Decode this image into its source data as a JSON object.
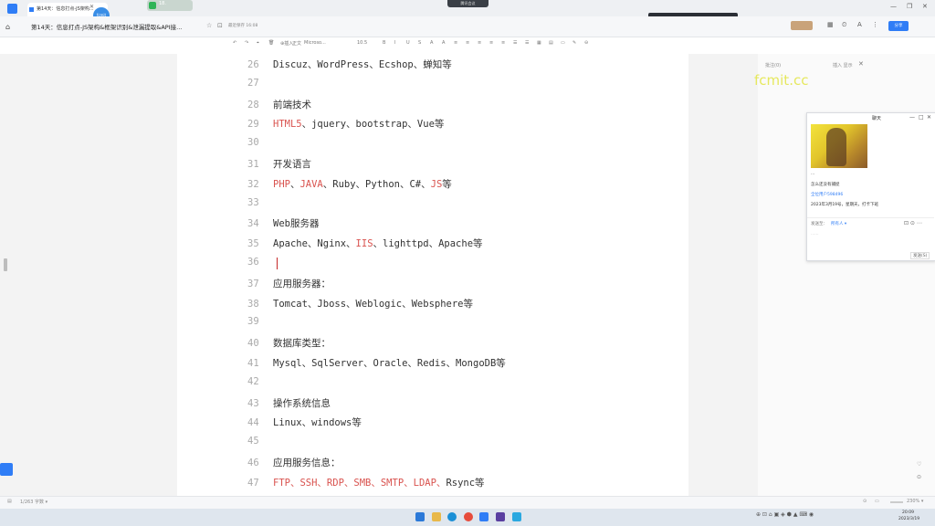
{
  "browser": {
    "tab_title": "第14天：信息打点-JS架构...",
    "avatar_label": "fcmit",
    "badge_text": "18.",
    "meeting_label": "腾讯会议",
    "notification_text": "正在讲话：小黑默金"
  },
  "document": {
    "title": "第14天：信息打点-JS架构&框架识别&泄漏提取&API接...",
    "save_status": "最近保存 16:08",
    "share_label": "分享"
  },
  "toolbar": {
    "items": [
      "↶",
      "↷",
      "⌖",
      "🗑",
      "⊕插入",
      "正文",
      "Microso...",
      "10.5",
      "B",
      "I",
      "U",
      "S",
      "A",
      "A",
      "≡",
      "≡",
      "≡",
      "≡",
      "≡",
      "☰",
      "☰",
      "▦",
      "▤",
      "▭",
      "✎",
      "⊖"
    ]
  },
  "editor": {
    "lines": [
      {
        "n": "26",
        "parts": [
          {
            "t": "Discuz、WordPress、Ecshop、蝉知等",
            "red": false
          }
        ]
      },
      {
        "n": "27",
        "parts": []
      },
      {
        "n": "28",
        "parts": [
          {
            "t": "前端技术",
            "red": false
          }
        ]
      },
      {
        "n": "29",
        "parts": [
          {
            "t": "HTML5",
            "red": true
          },
          {
            "t": "、jquery、bootstrap、Vue等",
            "red": false
          }
        ]
      },
      {
        "n": "30",
        "parts": []
      },
      {
        "n": "31",
        "parts": [
          {
            "t": "开发语言",
            "red": false
          }
        ]
      },
      {
        "n": "32",
        "parts": [
          {
            "t": "PHP",
            "red": true
          },
          {
            "t": "、",
            "red": false
          },
          {
            "t": "JAVA",
            "red": true
          },
          {
            "t": "、Ruby、Python、C#、",
            "red": false
          },
          {
            "t": "JS",
            "red": true
          },
          {
            "t": "等",
            "red": false
          }
        ]
      },
      {
        "n": "33",
        "parts": []
      },
      {
        "n": "34",
        "parts": [
          {
            "t": "Web服务器",
            "red": false
          }
        ]
      },
      {
        "n": "35",
        "parts": [
          {
            "t": "Apache、Nginx、",
            "red": false
          },
          {
            "t": "IIS",
            "red": true
          },
          {
            "t": "、lighttpd、Apache等",
            "red": false
          }
        ]
      },
      {
        "n": "36",
        "parts": []
      },
      {
        "n": "37",
        "parts": [
          {
            "t": "应用服务器：",
            "red": false
          }
        ]
      },
      {
        "n": "38",
        "parts": [
          {
            "t": "Tomcat、Jboss、Weblogic、Websphere等",
            "red": false
          }
        ]
      },
      {
        "n": "39",
        "parts": []
      },
      {
        "n": "40",
        "parts": [
          {
            "t": "数据库类型：",
            "red": false
          }
        ]
      },
      {
        "n": "41",
        "parts": [
          {
            "t": "Mysql、SqlServer、Oracle、Redis、MongoDB等",
            "red": false
          }
        ]
      },
      {
        "n": "42",
        "parts": []
      },
      {
        "n": "43",
        "parts": [
          {
            "t": "操作系统信息",
            "red": false
          }
        ]
      },
      {
        "n": "44",
        "parts": [
          {
            "t": "Linux、windows等",
            "red": false
          }
        ]
      },
      {
        "n": "45",
        "parts": []
      },
      {
        "n": "46",
        "parts": [
          {
            "t": "应用服务信息：",
            "red": false
          }
        ]
      },
      {
        "n": "47",
        "parts": [
          {
            "t": "FTP、SSH、RDP、SMB、SMTP、LDAP、",
            "red": true
          },
          {
            "t": "Rsync等",
            "red": false
          }
        ]
      }
    ]
  },
  "sidepanel": {
    "header_left": "批注(0)",
    "header_right": "插入 显示",
    "watermark": "fcmit.cc"
  },
  "popup": {
    "title": "聊天",
    "line1": "...",
    "line2": "怎么还没有捕捉",
    "line3": "全位用户598496",
    "line4": "2023年3月19号，星期天，打卡下班",
    "to_label": "发送至：",
    "to_value": "所有人 ▾",
    "send_label": "发送(S)"
  },
  "status": {
    "page_info": "1/263 字数 ▾",
    "zoom": "230% ▾"
  },
  "taskbar": {
    "time": "20:09",
    "date": "2023/3/19"
  }
}
